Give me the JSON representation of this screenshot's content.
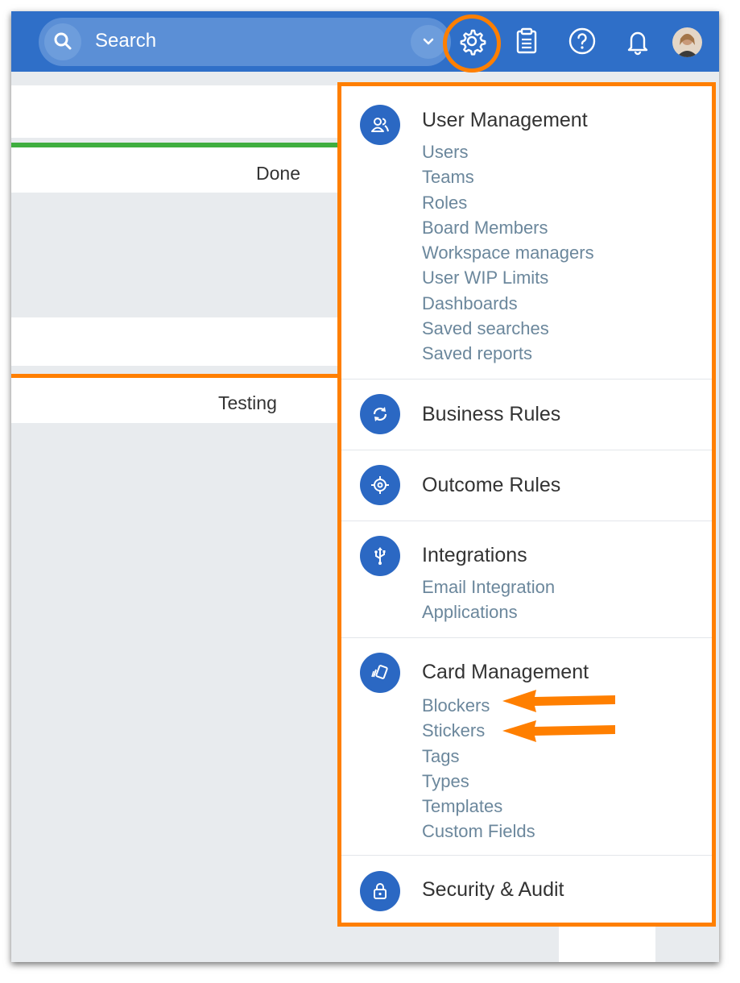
{
  "search": {
    "label": "Search"
  },
  "board": {
    "columns": [
      "Done",
      "Testing"
    ]
  },
  "colors": {
    "header": "#2f6fc8",
    "accent": "#ff7f00",
    "icon_bg": "#2b68c3",
    "link": "#6b879c",
    "done_bar": "#3fae3f"
  },
  "header_icons": [
    "search-icon",
    "chevron-down-icon",
    "gear-icon",
    "clipboard-icon",
    "help-icon",
    "bell-icon",
    "avatar"
  ],
  "menu": {
    "sections": [
      {
        "title": "User Management",
        "icon": "users-icon",
        "links": [
          "Users",
          "Teams",
          "Roles",
          "Board Members",
          "Workspace managers",
          "User WIP Limits",
          "Dashboards",
          "Saved searches",
          "Saved reports"
        ]
      },
      {
        "title": "Business Rules",
        "icon": "refresh-icon",
        "links": []
      },
      {
        "title": "Outcome Rules",
        "icon": "target-icon",
        "links": []
      },
      {
        "title": "Integrations",
        "icon": "usb-icon",
        "links": [
          "Email Integration",
          "Applications"
        ]
      },
      {
        "title": "Card Management",
        "icon": "card-icon",
        "links": [
          "Blockers",
          "Stickers",
          "Tags",
          "Types",
          "Templates",
          "Custom Fields"
        ]
      },
      {
        "title": "Security & Audit",
        "icon": "lock-icon",
        "links": []
      }
    ]
  }
}
